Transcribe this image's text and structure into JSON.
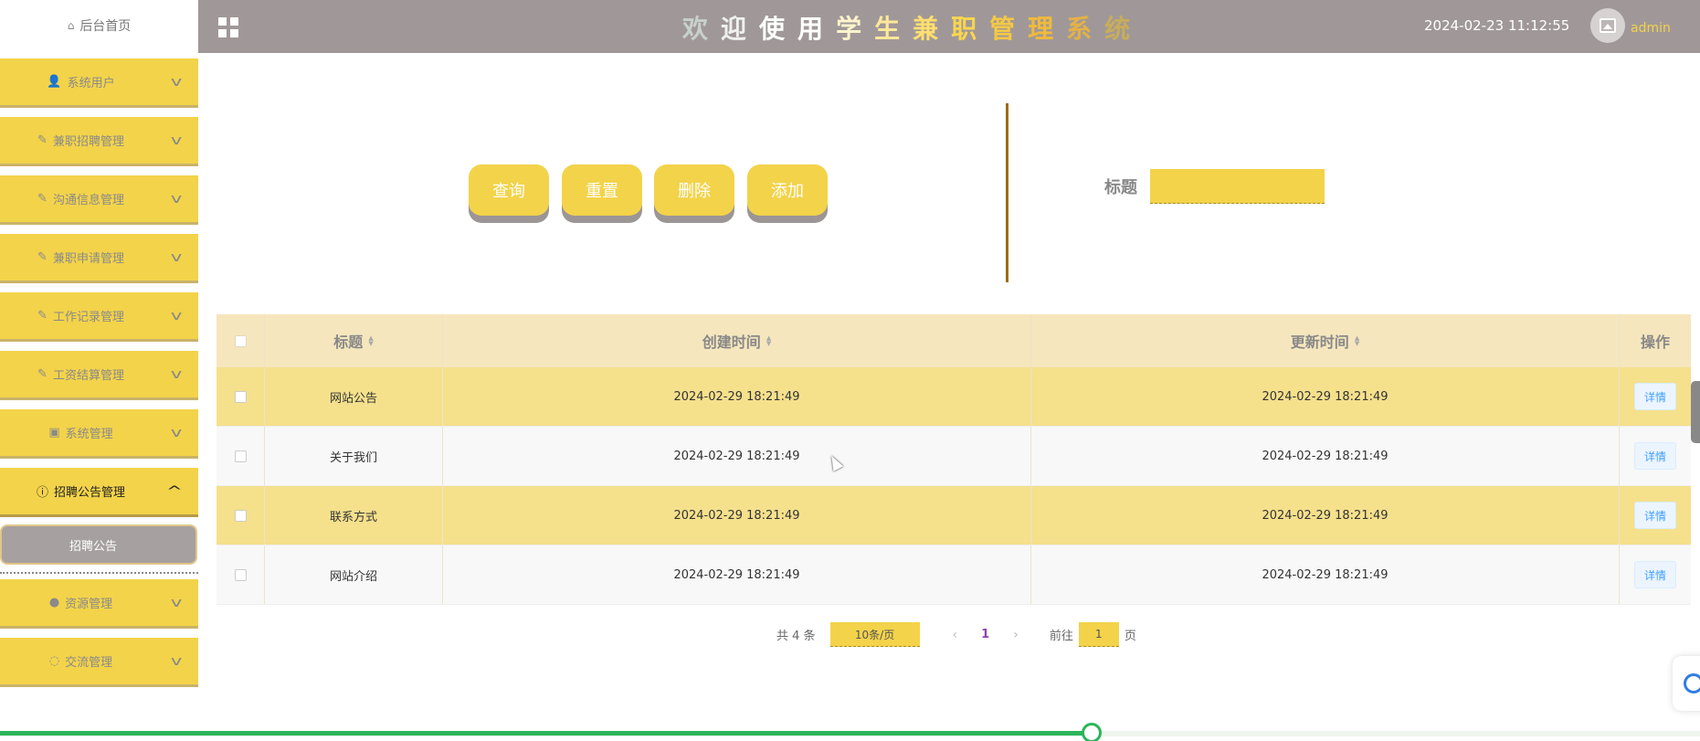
{
  "header": {
    "title_chars": [
      {
        "ch": "欢",
        "color": "#c9d0cc"
      },
      {
        "ch": "迎",
        "color": "#eef0ee"
      },
      {
        "ch": "使",
        "color": "#ffffff"
      },
      {
        "ch": "用",
        "color": "#ffffff"
      },
      {
        "ch": "学",
        "color": "#fff4cc"
      },
      {
        "ch": "生",
        "color": "#ffe79a"
      },
      {
        "ch": "兼",
        "color": "#ffdf6f"
      },
      {
        "ch": "职",
        "color": "#f8d64f"
      },
      {
        "ch": "管",
        "color": "#f3c845"
      },
      {
        "ch": "理",
        "color": "#efba3c"
      },
      {
        "ch": "系",
        "color": "#e3b148"
      },
      {
        "ch": "统",
        "color": "#c8ad5a"
      }
    ],
    "datetime": "2024-02-23 11:12:55",
    "username": "admin"
  },
  "sidebar": {
    "home": "后台首页",
    "items": [
      {
        "label": "系统用户",
        "icon": "user-icon"
      },
      {
        "label": "兼职招聘管理",
        "icon": "edit-icon"
      },
      {
        "label": "沟通信息管理",
        "icon": "edit-icon"
      },
      {
        "label": "兼职申请管理",
        "icon": "edit-icon"
      },
      {
        "label": "工作记录管理",
        "icon": "edit-icon"
      },
      {
        "label": "工资结算管理",
        "icon": "edit-icon"
      },
      {
        "label": "系统管理",
        "icon": "picture-icon"
      },
      {
        "label": "招聘公告管理",
        "icon": "info-icon",
        "open": true
      },
      {
        "label": "资源管理",
        "icon": "location-icon"
      },
      {
        "label": "交流管理",
        "icon": "chat-icon"
      }
    ],
    "sub_items": [
      "招聘公告"
    ]
  },
  "toolbar": {
    "query": "查询",
    "reset": "重置",
    "delete": "删除",
    "add": "添加"
  },
  "search": {
    "label": "标题",
    "value": ""
  },
  "table": {
    "headers": [
      "标题",
      "创建时间",
      "更新时间",
      "操作"
    ],
    "rows": [
      {
        "title": "网站公告",
        "created": "2024-02-29 18:21:49",
        "updated": "2024-02-29 18:21:49",
        "action": "详情"
      },
      {
        "title": "关于我们",
        "created": "2024-02-29 18:21:49",
        "updated": "2024-02-29 18:21:49",
        "action": "详情"
      },
      {
        "title": "联系方式",
        "created": "2024-02-29 18:21:49",
        "updated": "2024-02-29 18:21:49",
        "action": "详情"
      },
      {
        "title": "网站介绍",
        "created": "2024-02-29 18:21:49",
        "updated": "2024-02-29 18:21:49",
        "action": "详情"
      }
    ]
  },
  "pagination": {
    "total": "共 4 条",
    "page_size": "10条/页",
    "current_page": "1",
    "goto_prefix": "前往",
    "goto_value": "1",
    "goto_suffix": "页"
  },
  "progress": {
    "fraction": 0.642
  },
  "colors": {
    "accent": "#f3d34a",
    "header_bg": "#a09898",
    "submenu_bg": "#a7a0a0",
    "progress": "#2bb55a"
  }
}
